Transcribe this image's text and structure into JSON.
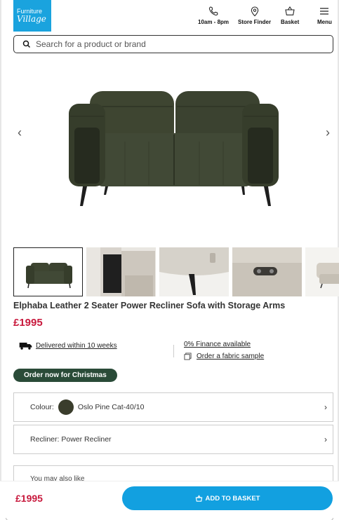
{
  "header": {
    "logo_line1": "Furniture",
    "logo_line2": "Village",
    "hours_label": "10am - 8pm",
    "store_finder_label": "Store Finder",
    "basket_label": "Basket",
    "menu_label": "Menu"
  },
  "search": {
    "placeholder": "Search for a product or brand"
  },
  "gallery": {
    "prev_icon": "chevron-left-icon",
    "next_icon": "chevron-right-icon",
    "thumbnails": 5,
    "selected_index": 0
  },
  "product": {
    "title": "Elphaba Leather 2 Seater Power Recliner Sofa with Storage Arms",
    "price": "£1995"
  },
  "info": {
    "delivery": "Delivered within 10 weeks",
    "finance": "0% Finance available",
    "fabric_sample": "Order a fabric sample"
  },
  "badge": "Order now for Christmas",
  "options": {
    "colour_label": "Colour:",
    "colour_value": "Oslo Pine Cat-40/10",
    "colour_swatch": "#3a3d2c",
    "recliner": "Recliner: Power Recliner"
  },
  "also_like": "You may also like",
  "footer": {
    "price": "£1995",
    "add_to_basket": "ADD TO BASKET"
  },
  "colors": {
    "brand_blue": "#1aa3de",
    "price_red": "#c8193d",
    "badge_green": "#2a4b38",
    "button_blue": "#12a0e0"
  }
}
